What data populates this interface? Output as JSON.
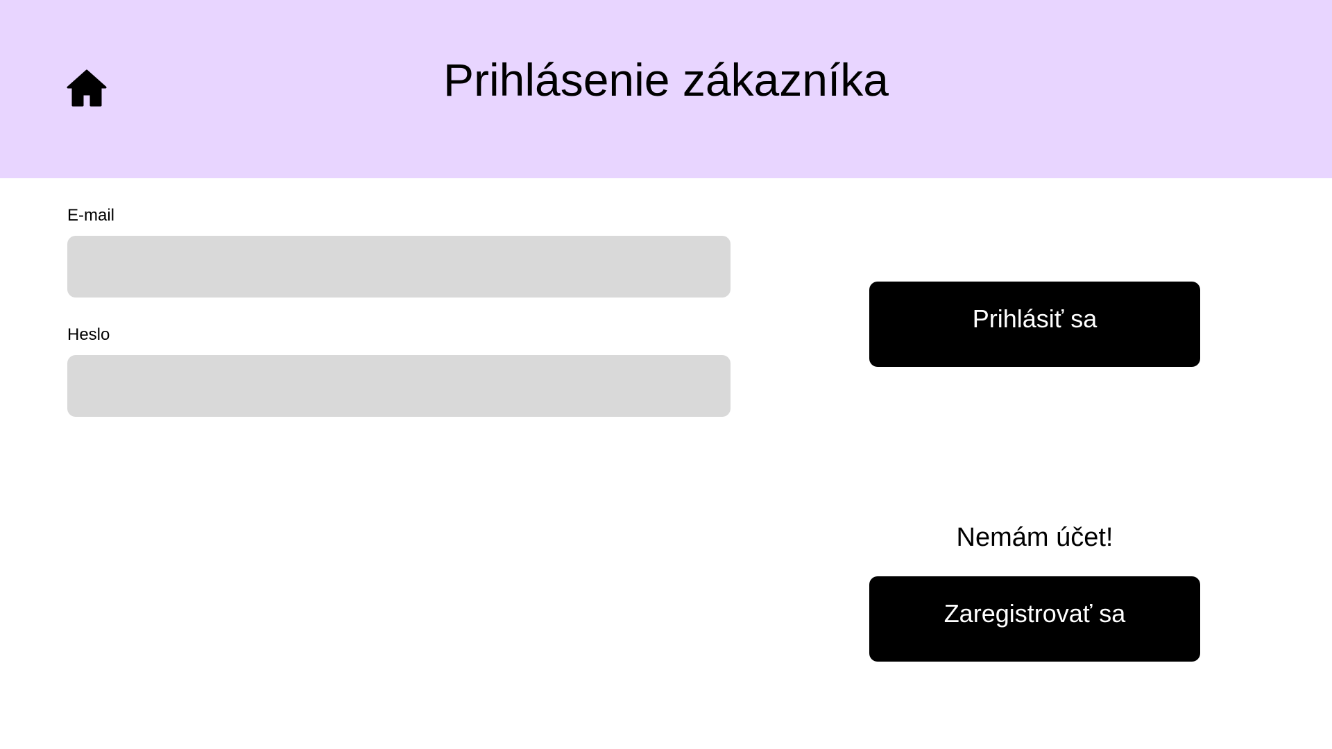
{
  "header": {
    "title": "Prihlásenie zákazníka",
    "home_icon": "home-icon",
    "background": "#e8d5ff"
  },
  "form": {
    "email": {
      "label": "E-mail",
      "value": "",
      "placeholder": ""
    },
    "password": {
      "label": "Heslo",
      "value": "",
      "placeholder": ""
    },
    "input_background": "#d9d9d9"
  },
  "actions": {
    "login_label": "Prihlásiť sa",
    "no_account_text": "Nemám účet!",
    "register_label": "Zaregistrovať sa",
    "button_background": "#000000",
    "button_text_color": "#ffffff"
  }
}
